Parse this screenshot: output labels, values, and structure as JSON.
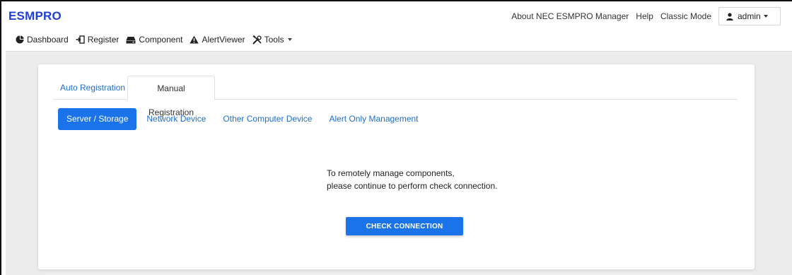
{
  "header": {
    "brand": "ESMPRO",
    "links": {
      "about": "About NEC ESMPRO Manager",
      "help": "Help",
      "classic": "Classic Mode"
    },
    "user": {
      "name": "admin",
      "icon": "user-icon"
    }
  },
  "nav": {
    "dashboard": "Dashboard",
    "register": "Register",
    "component": "Component",
    "alertviewer": "AlertViewer",
    "tools": "Tools"
  },
  "tabs": {
    "auto": "Auto Registration",
    "manual": "Manual Registration",
    "active": "Manual Registration"
  },
  "pills": {
    "server": "Server / Storage",
    "network": "Network Device",
    "other": "Other Computer Device",
    "alert": "Alert Only Management",
    "active": "Server / Storage"
  },
  "message": {
    "line1": "To remotely manage components,",
    "line2": "please continue to perform check connection."
  },
  "button": {
    "check": "CHECK CONNECTION"
  },
  "colors": {
    "brand": "#1f3fd6",
    "link": "#1f6fd0",
    "primary": "#1a73e8",
    "background": "#ececec"
  }
}
